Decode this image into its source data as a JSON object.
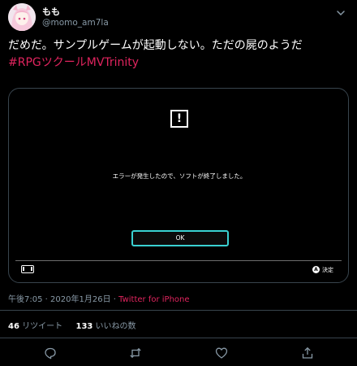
{
  "user": {
    "display_name": "もも",
    "handle": "@momo_am7la"
  },
  "tweet": {
    "text": "だめだ。サンプルゲームが起動しない。ただの屍のようだ",
    "hashtag": "#RPGツクールMVTrinity"
  },
  "media": {
    "error_message": "エラーが発生したので、ソフトが終了しました。",
    "ok_button": "OK",
    "confirm_button_glyph": "A",
    "confirm_label": "決定"
  },
  "meta": {
    "time": "午後7:05",
    "separator": "·",
    "date": "2020年1月26日",
    "source": "Twitter for iPhone"
  },
  "stats": {
    "retweet_count": "46",
    "retweet_label": "リツイート",
    "like_count": "133",
    "like_label": "いいねの数"
  },
  "icons": {
    "reply": "reply-icon",
    "retweet": "retweet-icon",
    "like": "like-icon",
    "share": "share-icon",
    "more": "chevron-down-icon"
  },
  "colors": {
    "background": "#000000",
    "hashtag": "#e0245e",
    "ok_border": "#3ad1d2",
    "secondary_text": "#8899a6"
  }
}
